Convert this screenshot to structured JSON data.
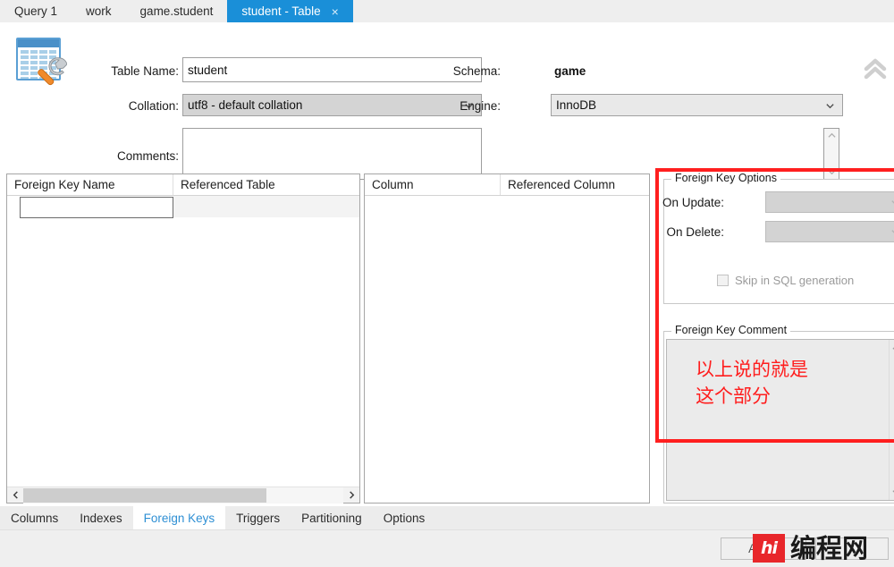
{
  "tabs": {
    "items": [
      {
        "label": "Query 1",
        "active": false
      },
      {
        "label": "work",
        "active": false
      },
      {
        "label": "game.student",
        "active": false
      },
      {
        "label": "student - Table",
        "active": true
      }
    ],
    "close_glyph": "×"
  },
  "editor": {
    "icon_name": "table-editor-icon",
    "table_name_label": "Table Name:",
    "table_name_value": "student",
    "collation_label": "Collation:",
    "collation_value": "utf8 - default collation",
    "comments_label": "Comments:",
    "comments_value": "",
    "schema_label": "Schema:",
    "schema_value": "game",
    "engine_label": "Engine:",
    "engine_value": "InnoDB",
    "collapse_icon": "chevron-double-up"
  },
  "fk_list": {
    "columns": [
      "Foreign Key Name",
      "Referenced Table"
    ],
    "rows": [
      {
        "name": "",
        "referenced_table": ""
      }
    ],
    "editing_value": ""
  },
  "column_list": {
    "columns": [
      "Column",
      "Referenced Column"
    ],
    "rows": []
  },
  "fk_options": {
    "title": "Foreign Key Options",
    "on_update_label": "On Update:",
    "on_update_value": "",
    "on_delete_label": "On Delete:",
    "on_delete_value": "",
    "skip_label": "Skip in SQL generation",
    "skip_checked": false
  },
  "fk_comment": {
    "title": "Foreign Key Comment",
    "value": ""
  },
  "annotation": {
    "line1": "以上说的就是",
    "line2": "这个部分",
    "color": "#ff1d1d"
  },
  "bottom_tabs": {
    "items": [
      {
        "label": "Columns",
        "active": false
      },
      {
        "label": "Indexes",
        "active": false
      },
      {
        "label": "Foreign Keys",
        "active": true
      },
      {
        "label": "Triggers",
        "active": false
      },
      {
        "label": "Partitioning",
        "active": false
      },
      {
        "label": "Options",
        "active": false
      }
    ]
  },
  "footer": {
    "apply_label": "Apply",
    "revert_label": ""
  },
  "watermark": {
    "logo_text": "hi",
    "text": "编程网"
  },
  "colors": {
    "accent": "#1a8fd8",
    "active_tab_text": "#2e8fd4",
    "annotation_red": "#ff1f1f",
    "watermark_red": "#e8262a"
  }
}
